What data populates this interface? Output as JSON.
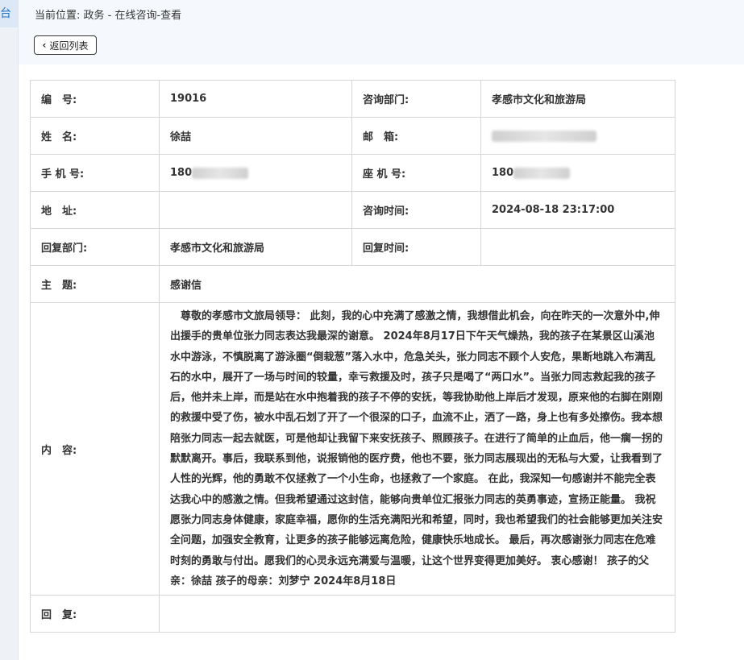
{
  "sidebar": {
    "active_tab_fragment": "台"
  },
  "breadcrumb": "当前位置: 政务 - 在线咨询-查看",
  "back_button": {
    "label": "返回列表"
  },
  "fields": {
    "number": {
      "label": "编　号:",
      "value": "19016"
    },
    "department": {
      "label": "咨询部门:",
      "value": "孝感市文化和旅游局"
    },
    "name": {
      "label": "姓　名:",
      "value": "徐喆"
    },
    "email": {
      "label": "邮　箱:",
      "value": ""
    },
    "mobile": {
      "label": "手 机 号:",
      "value": "180"
    },
    "landline": {
      "label": "座 机 号:",
      "value": "180"
    },
    "address": {
      "label": "地　址:",
      "value": ""
    },
    "consult_time": {
      "label": "咨询时间:",
      "value": "2024-08-18 23:17:00"
    },
    "reply_department": {
      "label": "回复部门:",
      "value": "孝感市文化和旅游局"
    },
    "reply_time": {
      "label": "回复时间:",
      "value": ""
    },
    "subject": {
      "label": "主　题:",
      "value": "感谢信"
    },
    "content": {
      "label": "内　容:",
      "value": "　尊敬的孝感市文旅局领导： 此刻，我的心中充满了感激之情，我想借此机会，向在昨天的一次意外中,伸出援手的贵单位张力同志表达我最深的谢意。 2024年8月17日下午天气燥热，我的孩子在某景区山溪池水中游泳，不慎脱离了游泳圈“倒栽葱”落入水中，危急关头，张力同志不顾个人安危，果断地跳入布满乱石的水中，展开了一场与时间的较量，幸亏救援及时，孩子只是喝了“两口水”。当张力同志救起我的孩子后，他并未上岸，而是站在水中抱着我的孩子不停的安抚，等我协助他上岸后才发现，原来他的右脚在刚刚的救援中受了伤，被水中乱石划了开了一个很深的口子，血流不止，洒了一路，身上也有多处擦伤。我本想陪张力同志一起去就医，可是他却让我留下来安抚孩子、照顾孩子。在进行了简单的止血后，他一瘸一拐的默默离开。事后，我联系到他，说报销他的医疗费，他也不要，张力同志展现出的无私与大爱，让我看到了人性的光辉，他的勇敢不仅拯救了一个小生命，也拯救了一个家庭。 在此，我深知一句感谢并不能完全表达我心中的感激之情。但我希望通过这封信，能够向贵单位汇报张力同志的英勇事迹，宣扬正能量。 我祝愿张力同志身体健康，家庭幸福，愿你的生活充满阳光和希望，同时，我也希望我们的社会能够更加关注安全问题，加强安全教育，让更多的孩子能够远离危险，健康快乐地成长。 最后，再次感谢张力同志在危难时刻的勇敢与付出。愿我们的心灵永远充满爱与温暖，让这个世界变得更加美好。 衷心感谢！ 孩子的父亲：徐喆 孩子的母亲：刘梦宁 2024年8月18日"
    },
    "reply": {
      "label": "回　复:",
      "value": ""
    }
  }
}
